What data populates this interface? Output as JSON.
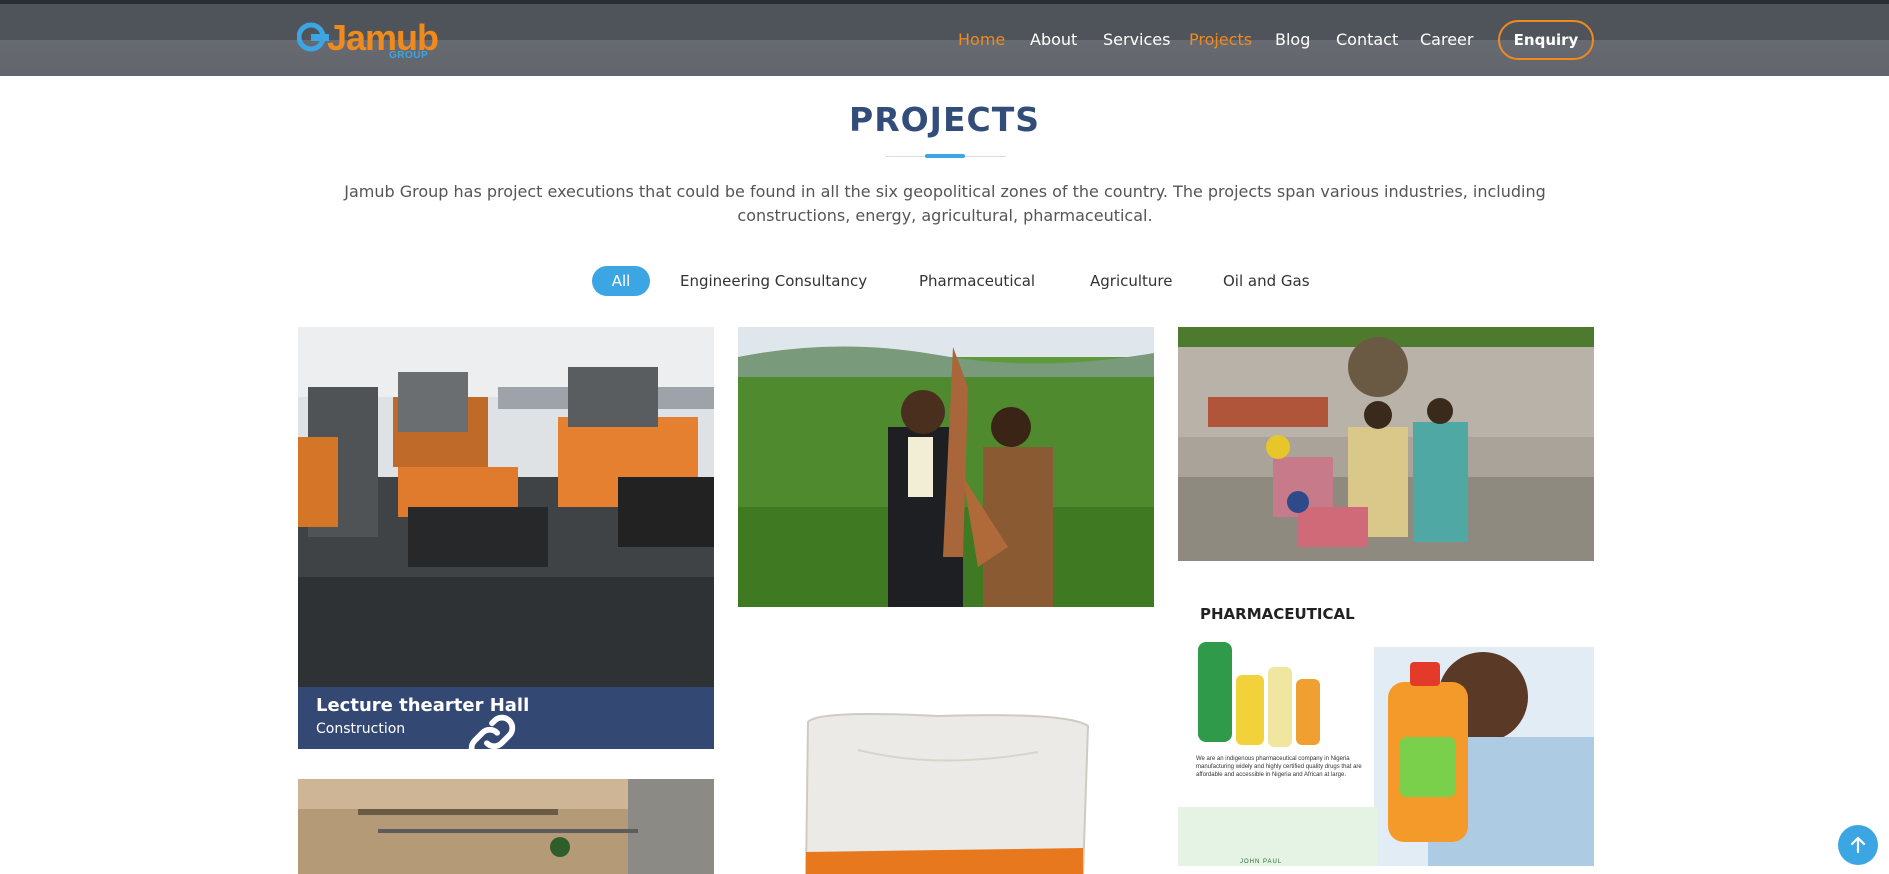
{
  "brand": {
    "name": "Jamub",
    "sub": "GROUP"
  },
  "nav": {
    "items": [
      {
        "label": "Home",
        "active": true
      },
      {
        "label": "About",
        "active": false
      },
      {
        "label": "Services",
        "active": false
      },
      {
        "label": "Projects",
        "active": true
      },
      {
        "label": "Blog",
        "active": false
      },
      {
        "label": "Contact",
        "active": false
      },
      {
        "label": "Career",
        "active": false
      }
    ],
    "enquiry": "Enquiry"
  },
  "section": {
    "title": "PROJECTS",
    "intro": "Jamub Group has project executions that could be found in all the six geopolitical zones of the country. The projects span various industries, including constructions, energy, agricultural, pharmaceutical."
  },
  "filters": [
    "All",
    "Engineering Consultancy",
    "Pharmaceutical",
    "Agriculture",
    "Oil and Gas"
  ],
  "projects": {
    "featured": {
      "title": "Lecture thearter Hall",
      "category": "Construction"
    },
    "pharma": {
      "heading": "PHARMACEUTICAL",
      "text": "We are an indigenous pharmaceutical company in Nigeria manufacturing widely and highly certified quality drugs that are affordable and accessible in Nigeria and African at large.",
      "brand": "JOHN PAUL"
    }
  },
  "colors": {
    "accent": "#f08a1d",
    "primary": "#324d7a",
    "highlight": "#3ba6e3"
  },
  "icons": {
    "link": "link-icon",
    "scroll_top": "arrow-up-icon"
  }
}
